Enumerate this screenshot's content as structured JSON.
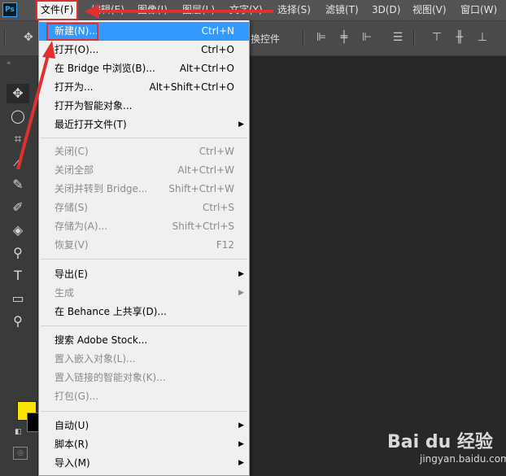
{
  "app_logo": "Ps",
  "menubar": {
    "items": [
      "文件(F)",
      "编辑(E)",
      "图像(I)",
      "图层(L)",
      "文字(Y)",
      "选择(S)",
      "滤镜(T)",
      "3D(D)",
      "视图(V)",
      "窗口(W)"
    ]
  },
  "options": {
    "transform_label": "换控件"
  },
  "file_menu": {
    "items": [
      {
        "label": "新建(N)...",
        "shortcut": "Ctrl+N"
      },
      {
        "label": "打开(O)...",
        "shortcut": "Ctrl+O"
      },
      {
        "label": "在 Bridge 中浏览(B)...",
        "shortcut": "Alt+Ctrl+O"
      },
      {
        "label": "打开为...",
        "shortcut": "Alt+Shift+Ctrl+O"
      },
      {
        "label": "打开为智能对象...",
        "shortcut": ""
      },
      {
        "label": "最近打开文件(T)",
        "shortcut": ""
      },
      {
        "label": "关闭(C)",
        "shortcut": "Ctrl+W"
      },
      {
        "label": "关闭全部",
        "shortcut": "Alt+Ctrl+W"
      },
      {
        "label": "关闭并转到 Bridge...",
        "shortcut": "Shift+Ctrl+W"
      },
      {
        "label": "存储(S)",
        "shortcut": "Ctrl+S"
      },
      {
        "label": "存储为(A)...",
        "shortcut": "Shift+Ctrl+S"
      },
      {
        "label": "恢复(V)",
        "shortcut": "F12"
      },
      {
        "label": "导出(E)",
        "shortcut": ""
      },
      {
        "label": "生成",
        "shortcut": ""
      },
      {
        "label": "在 Behance 上共享(D)...",
        "shortcut": ""
      },
      {
        "label": "搜索 Adobe Stock...",
        "shortcut": ""
      },
      {
        "label": "置入嵌入对象(L)...",
        "shortcut": ""
      },
      {
        "label": "置入链接的智能对象(K)...",
        "shortcut": ""
      },
      {
        "label": "打包(G)...",
        "shortcut": ""
      },
      {
        "label": "自动(U)",
        "shortcut": ""
      },
      {
        "label": "脚本(R)",
        "shortcut": ""
      },
      {
        "label": "导入(M)",
        "shortcut": ""
      }
    ]
  },
  "colors": {
    "foreground": "#fbe500",
    "background": "#000000",
    "highlight": "#3399ff",
    "annotation": "#e03030"
  },
  "watermark": {
    "brand": "Bai du 经验",
    "site": "jingyan.baidu.com"
  }
}
